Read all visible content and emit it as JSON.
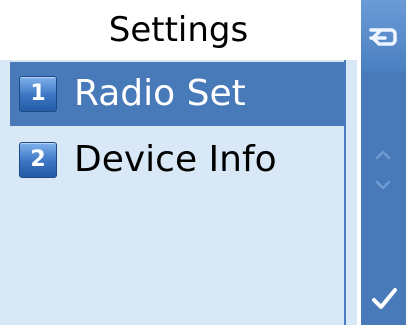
{
  "screen": {
    "title": "Settings"
  },
  "menu": {
    "items": [
      {
        "number": "1",
        "label": "Radio Set",
        "selected": true
      },
      {
        "number": "2",
        "label": "Device Info",
        "selected": false
      }
    ]
  },
  "rail": {
    "buttons": [
      {
        "icon": "back-arrow-icon"
      },
      {
        "icon": "chevron-up-icon"
      },
      {
        "icon": "chevron-down-icon"
      },
      {
        "icon": "checkmark-icon"
      }
    ]
  },
  "colors": {
    "selection": "#4879b9",
    "panel": "#d8e8f6",
    "rail": "#4879b9"
  }
}
